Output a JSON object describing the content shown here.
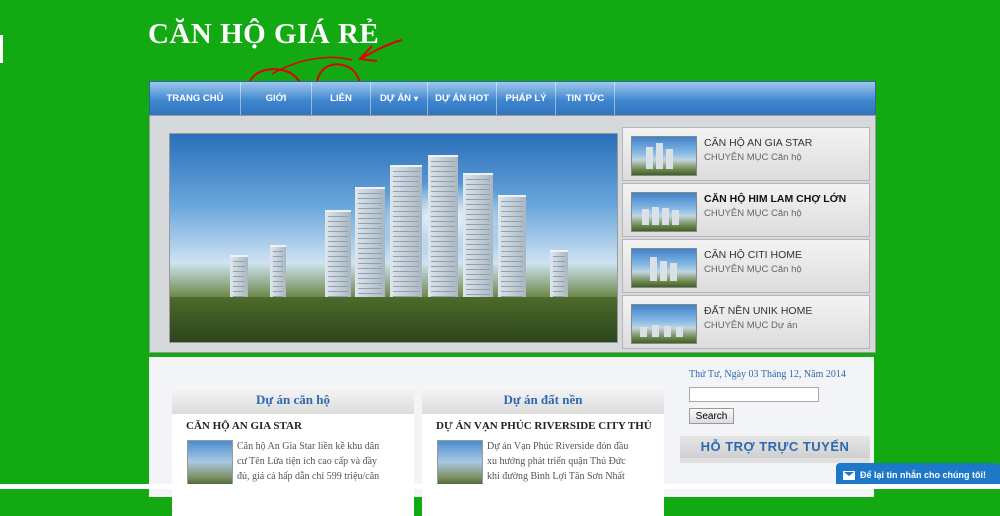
{
  "site": {
    "title": "CĂN HỘ GIÁ RẺ"
  },
  "nav": {
    "items": [
      {
        "label": "TRANG CHỦ",
        "dropdown": false
      },
      {
        "label": "GIỚI",
        "dropdown": false
      },
      {
        "label": "LIÊN",
        "dropdown": false
      },
      {
        "label": "DỰ ÁN",
        "dropdown": true
      },
      {
        "label": "DỰ ÁN HOT",
        "dropdown": false
      },
      {
        "label": "PHÁP LÝ",
        "dropdown": false
      },
      {
        "label": "TIN TỨC",
        "dropdown": false
      }
    ]
  },
  "slider": {
    "items": [
      {
        "title": "CĂN HỘ AN GIA STAR",
        "category": "CHUYÊN MỤC Căn hộ"
      },
      {
        "title": "CĂN HỘ HIM LAM CHỢ LỚN",
        "category": "CHUYÊN MỤC Căn hộ"
      },
      {
        "title": "CĂN HỘ CITI HOME",
        "category": "CHUYÊN MỤC Căn hộ"
      },
      {
        "title": "ĐẤT NỀN UNIK HOME",
        "category": "CHUYÊN MỤC Dự án"
      }
    ]
  },
  "boxes": [
    {
      "heading": "Dự án căn hộ",
      "item_title": "CĂN HỘ AN GIA STAR",
      "excerpt_lines": [
        "Căn hộ An Gia Star liền kề khu dân",
        "cư Tên Lửa tiện ích cao cấp và đầy",
        "đủ, giá cả hấp dẫn chỉ 599 triệu/căn"
      ]
    },
    {
      "heading": "Dự án đất nền",
      "item_title": "DỰ ÁN VẠN PHÚC RIVERSIDE CITY THỦ",
      "excerpt_lines": [
        "Dự án Vạn Phúc Riverside đón đầu",
        "xu hướng phát triển quận Thủ Đức",
        "khi đường Bình Lợi Tân Sơn Nhất"
      ]
    }
  ],
  "sidebar": {
    "date": "Thứ Tư, Ngày 03 Tháng 12, Năm 2014",
    "search_value": "",
    "search_button": "Search",
    "support_heading": "HỖ TRỢ TRỰC TUYẾN"
  },
  "chat": {
    "label": "Để lại tin nhắn cho chúng tôi!"
  },
  "colors": {
    "background": "#12a912",
    "nav": "#3f86cf",
    "accent_link": "#2d69b0",
    "annotation": "#e00000",
    "chat": "#1e78c8"
  }
}
